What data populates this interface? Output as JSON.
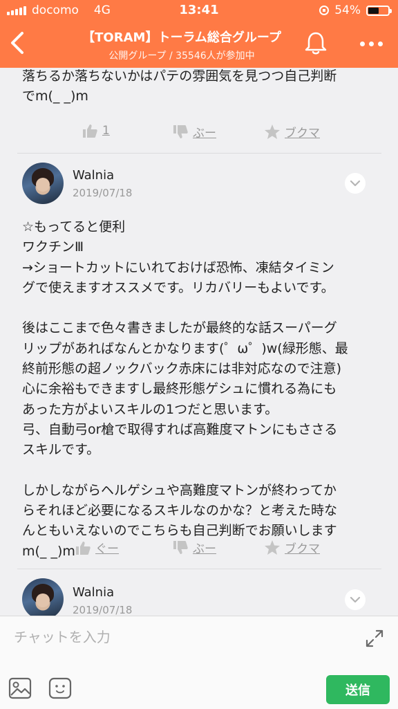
{
  "status_bar": {
    "carrier": "docomo",
    "network": "4G",
    "time": "13:41",
    "battery": "54%",
    "battery_level": 0.54
  },
  "header": {
    "title": "【TORAM】トーラム総合グループ",
    "subtitle": "公開グループ / 35546人が参加中"
  },
  "posts": [
    {
      "text": "落ちるか落ちないかはパテの雰囲気を見つつ自己判断\nでm(_ _)m",
      "like_label": "1",
      "dislike_label": "ぶー",
      "bookmark_label": "ブクマ"
    },
    {
      "author": "Walnia",
      "date": "2019/07/18",
      "text": "☆もってると便利\nワクチンⅢ\n→ショートカットにいれておけば恐怖、凍結タイミン\nグで使えますオススメです。リカバリーもよいです。\n\n後はここまで色々書きましたが最終的な話スーパーグ\nリップがあればなんとかなります(゜ω゜)w(緑形態、最\n終前形態の超ノックバック赤床には非対応なので注意)\n心に余裕もできますし最終形態ゲシュに慣れる為にも\nあった方がよいスキルの1つだと思います。\n弓、自動弓or槍で取得すれば高難度マトンにもささる\nスキルです。\n\nしかしながらヘルゲシュや高難度マトンが終わってか\nらそれほど必要になるスキルなのかな？と考えた時な\nんともいえないのでこちらも自己判断でお願いします\nm(_ _)m",
      "like_label": "ぐー",
      "dislike_label": "ぶー",
      "bookmark_label": "ブクマ"
    },
    {
      "author": "Walnia",
      "date": "2019/07/18"
    }
  ],
  "composer": {
    "placeholder": "チャットを入力",
    "send_label": "送信"
  },
  "colors": {
    "header_bg": "#ff7a45",
    "send_bg": "#2fb85f",
    "action_gray": "#9a9a9a"
  }
}
